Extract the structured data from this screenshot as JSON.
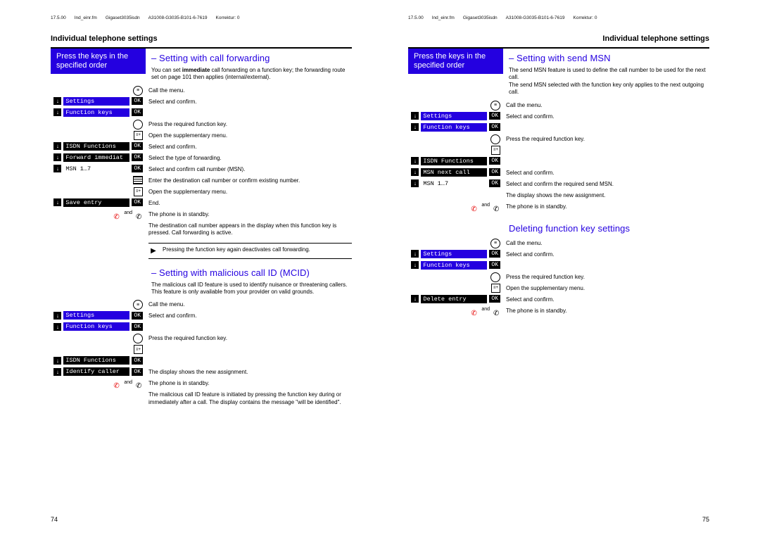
{
  "meta": {
    "date": "17.5.00",
    "file": "Ind_einr.fm",
    "model": "Gigaset3035isdn",
    "code": "A31008-G3035-B101-6-7619",
    "korrektur": "Korrektur: 0"
  },
  "section_title": "Individual telephone settings",
  "banner": "Press the keys in the specified order",
  "page_left": {
    "h1": "– Setting with call forwarding",
    "p1_a": "You can set ",
    "p1_b": "immediate",
    "p1_c": " call forwarding on a function key; the forwarding route set on page 101 then applies (internal/external).",
    "steps1": [
      {
        "icon": "menu-circle",
        "text": "Call the menu."
      },
      {
        "menu": "Settings",
        "ok": true,
        "blue": true,
        "text": "Select and confirm."
      },
      {
        "menu": "Function keys",
        "ok": true,
        "blue": true,
        "text": ""
      },
      {
        "icon": "circle",
        "text": "Press the required function key."
      },
      {
        "icon": "square",
        "text": "Open the supplementary menu."
      },
      {
        "menu": "ISDN Functions",
        "ok": true,
        "text": "Select and confirm."
      },
      {
        "menu": "Forward immediat",
        "ok": true,
        "text": "Select the type of forwarding."
      },
      {
        "menu": "MSN 1…7",
        "ok": true,
        "white": true,
        "text": "Select and confirm call number (MSN)."
      },
      {
        "icon": "keypad",
        "text": "Enter the destination call number or confirm existing number."
      },
      {
        "icon": "square",
        "text": "Open the supplementary menu."
      },
      {
        "menu": "Save entry",
        "ok": true,
        "text": "End."
      },
      {
        "icon": "handset-pair",
        "text": "The phone is in standby."
      }
    ],
    "p2": "The destination call number appears in the display when this function key is pressed. Call forwarding is active.",
    "note1": "Pressing the function key again deactivates call forwarding.",
    "h2": "– Setting with malicious call ID (MCID)",
    "p3": "The malicious call ID feature is used to identify nuisance or threatening callers. This feature is only available from your provider on valid grounds.",
    "steps2": [
      {
        "icon": "menu-circle",
        "text": "Call the menu."
      },
      {
        "menu": "Settings",
        "ok": true,
        "blue": true,
        "text": "Select and confirm."
      },
      {
        "menu": "Function keys",
        "ok": true,
        "blue": true,
        "text": ""
      },
      {
        "icon": "circle",
        "text": "Press the required function key."
      },
      {
        "icon": "square",
        "text": ""
      },
      {
        "menu": "ISDN Functions",
        "ok": true,
        "text": ""
      },
      {
        "menu": "Identify caller",
        "ok": true,
        "text": "The display shows the new assignment."
      },
      {
        "icon": "handset-pair",
        "text": "The phone is in standby."
      }
    ],
    "p4": "The malicious call ID feature is initiated by pressing the function key during or immediately after a call. The display contains the message \"will be identified\".",
    "num": "74"
  },
  "page_right": {
    "h1": "– Setting with send MSN",
    "p1": "The send MSN feature is used to define the call number to be used for the next call.\nThe send MSN selected with the function key only applies to the next outgoing call.",
    "steps1": [
      {
        "icon": "menu-circle",
        "text": "Call the menu."
      },
      {
        "menu": "Settings",
        "ok": true,
        "blue": true,
        "text": "Select and confirm."
      },
      {
        "menu": "Function keys",
        "ok": true,
        "blue": true,
        "text": ""
      },
      {
        "icon": "circle",
        "text": "Press the required function key."
      },
      {
        "icon": "square",
        "text": ""
      },
      {
        "menu": "ISDN Functions",
        "ok": true,
        "text": ""
      },
      {
        "menu": "MSN next call",
        "ok": true,
        "text": "Select and confirm."
      },
      {
        "menu": "MSN 1…7",
        "ok": true,
        "white": true,
        "text": "Select and confirm the required send MSN."
      }
    ],
    "p2": "The display shows the new assignment.",
    "standby1": "The phone is in standby.",
    "h2": "Deleting function key settings",
    "steps2": [
      {
        "icon": "menu-circle",
        "text": "Call the menu."
      },
      {
        "menu": "Settings",
        "ok": true,
        "blue": true,
        "text": "Select and confirm."
      },
      {
        "menu": "Function keys",
        "ok": true,
        "blue": true,
        "text": ""
      },
      {
        "icon": "circle",
        "text": "Press the required function key."
      },
      {
        "icon": "square",
        "text": "Open the supplementary menu."
      },
      {
        "menu": "Delete entry",
        "ok": true,
        "text": "Select and confirm."
      },
      {
        "icon": "handset-pair",
        "text": "The phone is in standby."
      }
    ],
    "num": "75"
  },
  "labels": {
    "ok": "OK",
    "and": "and"
  }
}
